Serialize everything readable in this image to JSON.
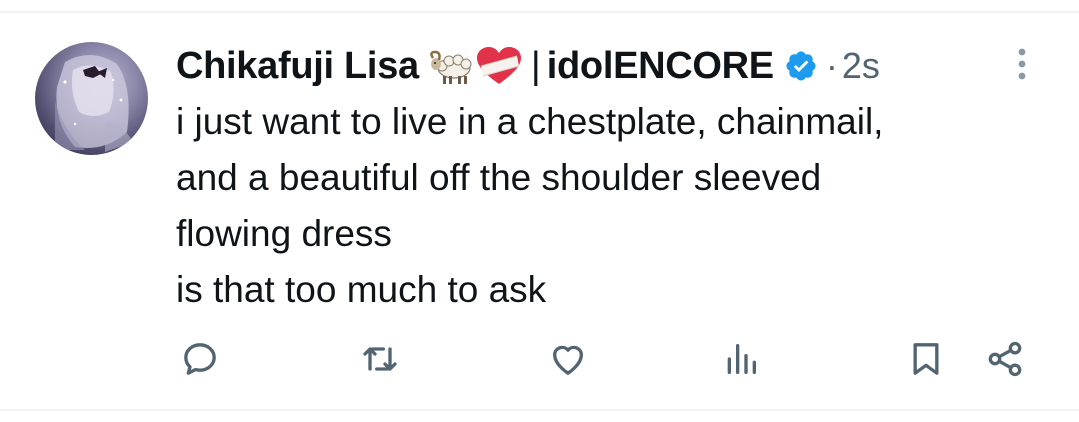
{
  "tweet": {
    "author_name": "Chikafuji Lisa",
    "name_emojis": [
      "ram",
      "mending-heart"
    ],
    "separator": "|",
    "handle_suffix": "idolENCORE",
    "verified": true,
    "time_prefix": "·",
    "time": "2s",
    "text_lines": [
      "i just want to live in a chestplate, chainmail,",
      "and a beautiful off the shoulder sleeved",
      "flowing dress",
      "is that too much to ask"
    ]
  },
  "colors": {
    "text": "#0f1419",
    "secondary": "#536471",
    "verified_blue": "#1d9bf0",
    "divider": "#eff3f4"
  },
  "actions": [
    {
      "name": "reply",
      "icon": "reply-icon"
    },
    {
      "name": "retweet",
      "icon": "retweet-icon"
    },
    {
      "name": "like",
      "icon": "heart-icon"
    },
    {
      "name": "views",
      "icon": "views-icon"
    },
    {
      "name": "bookmark",
      "icon": "bookmark-icon"
    },
    {
      "name": "share",
      "icon": "share-icon"
    }
  ]
}
